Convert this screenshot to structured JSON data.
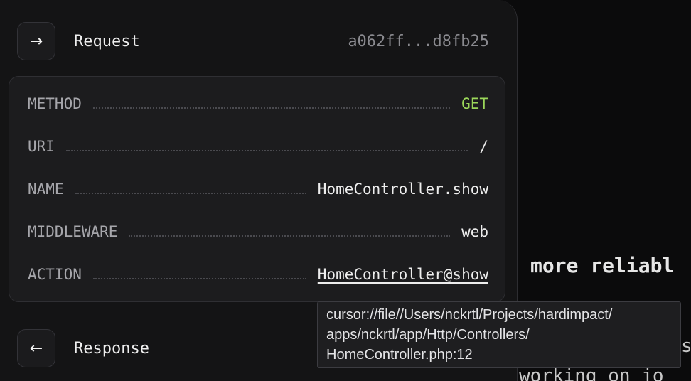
{
  "background": {
    "heading": "more reliabl",
    "text_a": "s",
    "text_b": "working on jo"
  },
  "request": {
    "icon": "arrow-right-icon",
    "icon_glyph": "→",
    "title": "Request",
    "hash": "a062ff...d8fb25"
  },
  "details": [
    {
      "label": "METHOD",
      "value": "GET"
    },
    {
      "label": "URI",
      "value": "/"
    },
    {
      "label": "NAME",
      "value": "HomeController.show"
    },
    {
      "label": "MIDDLEWARE",
      "value": "web"
    },
    {
      "label": "ACTION",
      "value": "HomeController@show"
    }
  ],
  "tooltip": {
    "lines": [
      "cursor://file//Users/nckrtl/Projects/hardimpact/",
      "apps/nckrtl/app/Http/Controllers/",
      "HomeController.php:12"
    ]
  },
  "response": {
    "icon": "arrow-left-icon",
    "icon_glyph": "←",
    "title": "Response"
  },
  "colors": {
    "method_accent": "#9bd75a",
    "panel_bg": "#141415",
    "card_bg": "#1c1c1e"
  }
}
